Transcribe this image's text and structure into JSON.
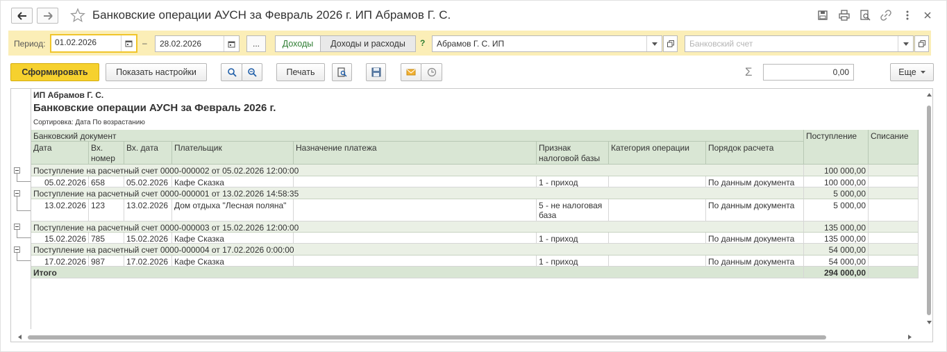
{
  "window": {
    "title": "Банковские операции АУСН за Февраль 2026 г. ИП Абрамов Г. С."
  },
  "filters": {
    "period_label": "Период:",
    "date_from": "01.02.2026",
    "dash": "–",
    "date_to": "28.02.2026",
    "more_label": "...",
    "mode_income": "Доходы",
    "mode_income_expense": "Доходы и расходы",
    "help": "?",
    "organization": "Абрамов Г. С. ИП",
    "bank_account_placeholder": "Банковский счет"
  },
  "toolbar": {
    "generate": "Сформировать",
    "show_settings": "Показать настройки",
    "print": "Печать",
    "sum_symbol": "Σ",
    "sum_value": "0,00",
    "more": "Еще"
  },
  "report": {
    "org": "ИП Абрамов Г. С.",
    "title": "Банковские операции АУСН  за Февраль 2026 г.",
    "sort": "Сортировка: Дата По возрастанию",
    "header": {
      "group": "Банковский документ",
      "date": "Дата",
      "in_number": "Вх.\nномер",
      "in_date": "Вх. дата",
      "payer": "Плательщик",
      "purpose": "Назначение платежа",
      "tax_sign": "Признак\nналоговой базы",
      "category": "Категория операции",
      "calc_order": "Порядок расчета",
      "income": "Поступление",
      "expense": "Списание"
    },
    "groups": [
      {
        "title": "Поступление на расчетный счет 0000-000002 от 05.02.2026 12:00:00",
        "income": "100 000,00",
        "row": {
          "date": "05.02.2026",
          "in_number": "658",
          "in_date": "05.02.2026",
          "payer": "Кафе Сказка",
          "purpose": "",
          "tax_sign": "1 - приход",
          "category": "",
          "calc_order": "По данным документа",
          "income": "100 000,00",
          "expense": ""
        }
      },
      {
        "title": "Поступление на расчетный счет 0000-000001 от 13.02.2026 14:58:35",
        "income": "5 000,00",
        "row": {
          "date": "13.02.2026",
          "in_number": "123",
          "in_date": "13.02.2026",
          "payer": "Дом отдыха \"Лесная поляна\"",
          "purpose": "",
          "tax_sign": "5 - не налоговая\nбаза",
          "category": "",
          "calc_order": "По данным документа",
          "income": "5 000,00",
          "expense": ""
        }
      },
      {
        "title": "Поступление на расчетный счет 0000-000003 от 15.02.2026 12:00:00",
        "income": "135 000,00",
        "row": {
          "date": "15.02.2026",
          "in_number": "785",
          "in_date": "15.02.2026",
          "payer": "Кафе Сказка",
          "purpose": "",
          "tax_sign": "1 - приход",
          "category": "",
          "calc_order": "По данным документа",
          "income": "135 000,00",
          "expense": ""
        }
      },
      {
        "title": "Поступление на расчетный счет 0000-000004 от 17.02.2026 0:00:00",
        "income": "54 000,00",
        "row": {
          "date": "17.02.2026",
          "in_number": "987",
          "in_date": "17.02.2026",
          "payer": "Кафе Сказка",
          "purpose": "",
          "tax_sign": "1 - приход",
          "category": "",
          "calc_order": "По данным документа",
          "income": "54 000,00",
          "expense": ""
        }
      }
    ],
    "total_label": "Итого",
    "total_income": "294 000,00"
  },
  "colors": {
    "filter_bg": "#fbeeb7",
    "primary_button": "#f6d12e",
    "header_green": "#d9e6d4",
    "group_green": "#eaf0e5",
    "mode_active_text": "#2e7d32"
  },
  "icons": [
    "back-arrow-icon",
    "forward-arrow-icon",
    "star-icon",
    "save-icon",
    "print-icon",
    "preview-icon",
    "link-icon",
    "more-vertical-icon",
    "close-icon",
    "calendar-icon",
    "dropdown-icon",
    "open-icon",
    "search-icon",
    "search-next-icon",
    "print-preview-icon",
    "save-disk-icon",
    "mail-icon",
    "clock-icon",
    "sum-icon"
  ]
}
